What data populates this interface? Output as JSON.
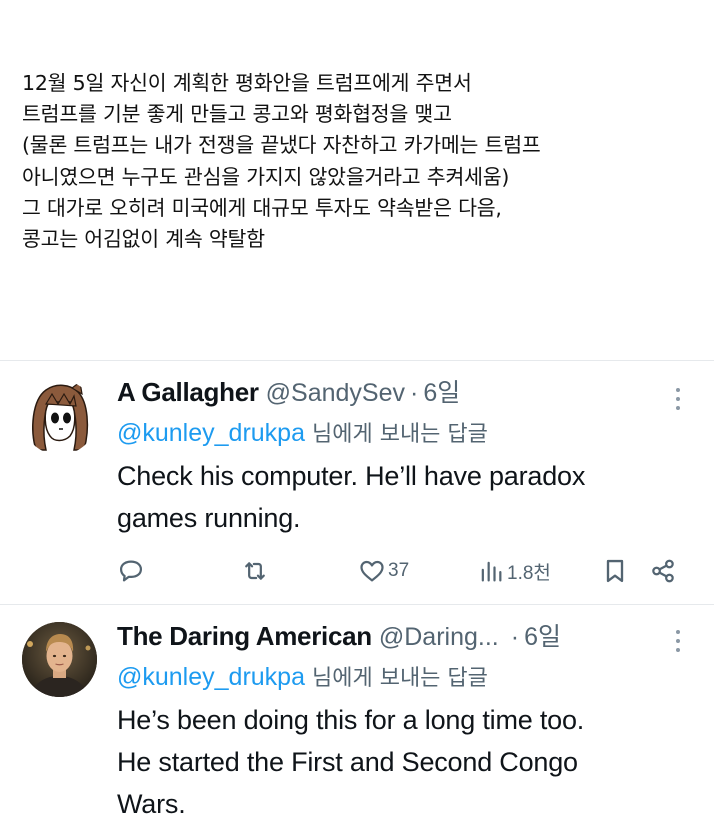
{
  "post": {
    "lines": [
      "12월 5일 자신이 계획한 평화안을 트럼프에게 주면서",
      "트럼프를 기분 좋게 만들고 콩고와 평화협정을 맺고",
      "(물론 트럼프는 내가 전쟁을 끝냈다 자찬하고 카가메는 트럼프",
      "아니였으면 누구도 관심을 가지지 않았을거라고 추켜세움)",
      "그 대가로 오히려 미국에게 대규모 투자도 약속받은 다음,",
      "콩고는 어김없이 계속 약탈함"
    ]
  },
  "replies": [
    {
      "display_name": "A Gallagher",
      "handle": "@SandySev",
      "separator": "·",
      "time": "6일",
      "mention": "@kunley_drukpa",
      "replying_suffix": " 님에게 보내는 답글",
      "body_lines": [
        "Check his computer. He’ll have paradox",
        "games running."
      ],
      "stats": {
        "likes": "37",
        "views": "1.8천"
      }
    },
    {
      "display_name": "The Daring American",
      "handle": "@Daring...",
      "separator": "·",
      "time": "6일",
      "mention": "@kunley_drukpa",
      "replying_suffix": " 님에게 보내는 답글",
      "body_lines": [
        "He’s been doing this for a long time too.",
        "He started the First and Second Congo",
        "Wars."
      ]
    }
  ],
  "icons": {
    "reply": "comment-bubble-icon",
    "retweet": "retweet-icon",
    "like": "heart-icon",
    "views": "views-bar-chart-icon",
    "bookmark": "bookmark-icon",
    "share": "share-icon",
    "more": "more-dots-icon"
  },
  "colors": {
    "mention": "#1d9bf0",
    "secondary_text": "#536471",
    "primary_text": "#0f1419"
  }
}
